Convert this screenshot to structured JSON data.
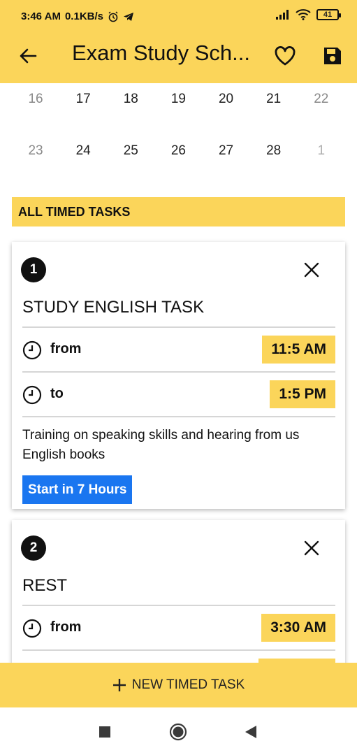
{
  "status_bar": {
    "time": "3:46 AM",
    "net_speed": "0.1KB/s",
    "battery": "41"
  },
  "app_bar": {
    "title": "Exam Study Sch..."
  },
  "calendar": {
    "weeks": [
      [
        "16",
        "17",
        "18",
        "19",
        "20",
        "21",
        "22"
      ],
      [
        "23",
        "24",
        "25",
        "26",
        "27",
        "28",
        "1"
      ]
    ]
  },
  "section": {
    "title": "ALL TIMED TASKS"
  },
  "tasks": [
    {
      "number": "1",
      "title": "STUDY ENGLISH TASK",
      "from_label": "from",
      "from_time": "11:5 AM",
      "to_label": "to",
      "to_time": "1:5 PM",
      "description": "Training on speaking skills and hearing from us English books",
      "start_label": "Start in 7 Hours"
    },
    {
      "number": "2",
      "title": "REST",
      "from_label": "from",
      "from_time": "3:30 AM"
    }
  ],
  "bottom_action": {
    "label": "NEW TIMED TASK"
  },
  "colors": {
    "accent": "#fbd55a",
    "button_blue": "#1a76f0",
    "badge": "#111111"
  },
  "icons": {
    "back": "arrow-left",
    "favorite": "heart-outline",
    "save": "floppy-disk",
    "close": "x",
    "clock": "clock-outline",
    "add": "plus",
    "nav_recents": "square",
    "nav_home": "circle",
    "nav_back": "triangle-left"
  }
}
